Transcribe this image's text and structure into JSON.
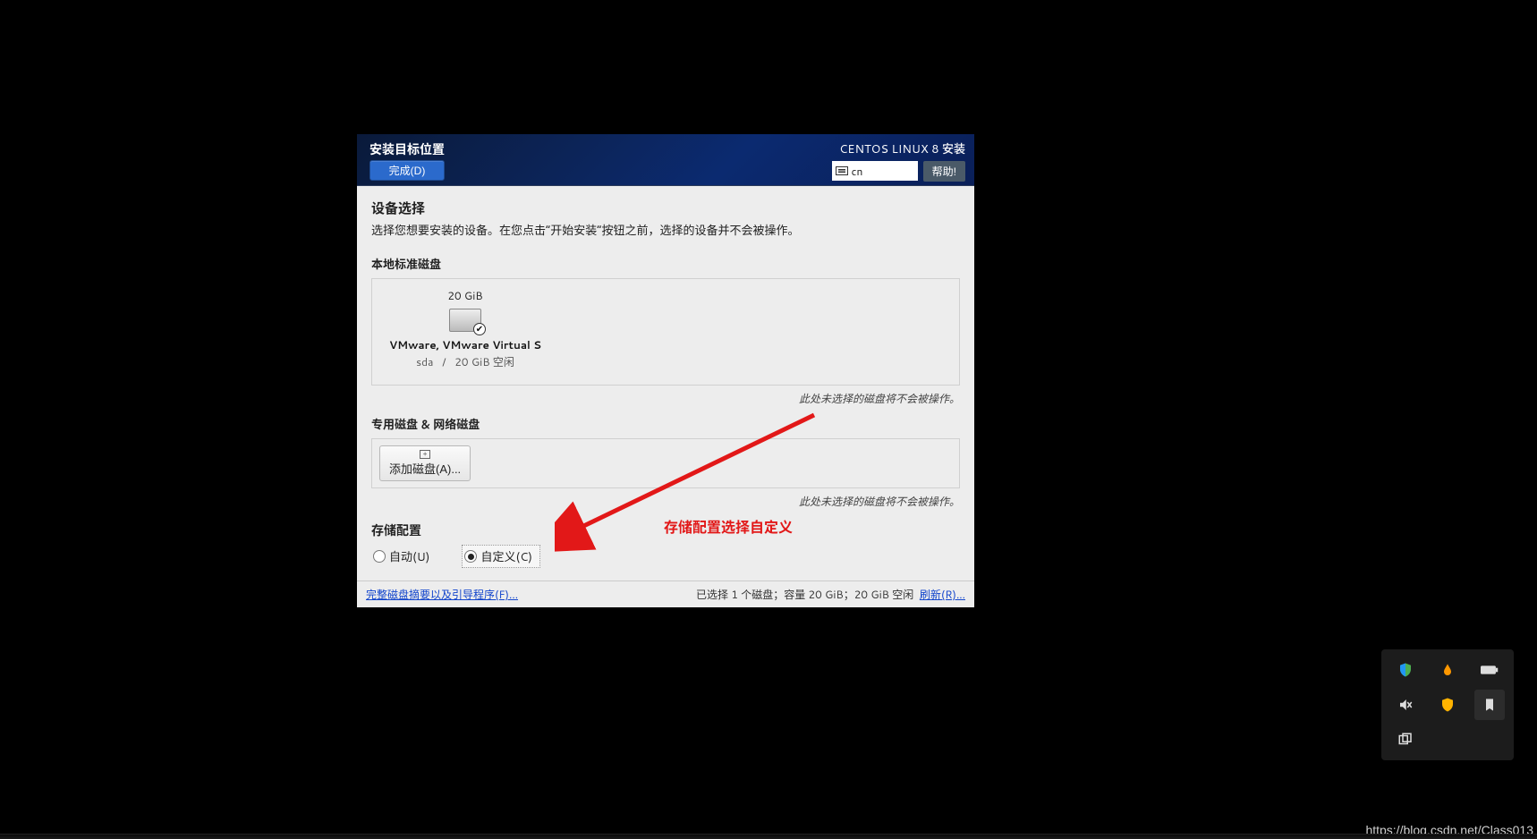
{
  "header": {
    "title": "安装目标位置",
    "done_label": "完成(D)",
    "brand": "CENTOS LINUX 8 安装",
    "lang_code": "cn",
    "help_label": "帮助!"
  },
  "device_selection": {
    "title": "设备选择",
    "desc": "选择您想要安装的设备。在您点击“开始安装”按钮之前，选择的设备并不会被操作。"
  },
  "local_disks": {
    "title": "本地标准磁盘",
    "disk": {
      "size": "20 GiB",
      "name": "VMware, VMware Virtual S",
      "dev": "sda",
      "sep": "/",
      "free": "20 GiB 空闲"
    },
    "note": "此处未选择的磁盘将不会被操作。"
  },
  "special_disks": {
    "title": "专用磁盘 & 网络磁盘",
    "add_label": "添加磁盘(A)...",
    "note": "此处未选择的磁盘将不会被操作。"
  },
  "storage_cfg": {
    "title": "存储配置",
    "auto_label": "自动(U)",
    "custom_label": "自定义(C)"
  },
  "footer": {
    "left_link": "完整磁盘摘要以及引导程序(F)...",
    "summary": "已选择 1 个磁盘；容量 20 GiB；20 GiB 空闲",
    "refresh_link": "刷新(R)..."
  },
  "annotation": {
    "text": "存储配置选择自定义"
  },
  "watermark": {
    "url": "https://blog.csdn.net/Class013"
  },
  "tray": {
    "icons": [
      "shield-icon",
      "droplet-icon",
      "battery-icon",
      "mute-icon",
      "defender-icon",
      "bookmark-icon",
      "multitask-icon",
      "",
      ""
    ]
  }
}
